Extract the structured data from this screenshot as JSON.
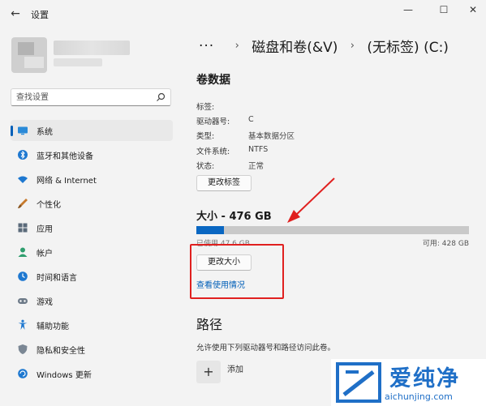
{
  "window": {
    "title": "设置",
    "back_glyph": "←",
    "min_glyph": "—",
    "max_glyph": "☐",
    "close_glyph": "✕"
  },
  "search": {
    "placeholder": "查找设置"
  },
  "sidebar": {
    "items": [
      {
        "label": "系统",
        "icon": "monitor-icon",
        "active": true
      },
      {
        "label": "蓝牙和其他设备",
        "icon": "bluetooth-icon"
      },
      {
        "label": "网络 & Internet",
        "icon": "wifi-icon"
      },
      {
        "label": "个性化",
        "icon": "brush-icon"
      },
      {
        "label": "应用",
        "icon": "apps-icon"
      },
      {
        "label": "帐户",
        "icon": "person-icon"
      },
      {
        "label": "时间和语言",
        "icon": "globe-clock-icon"
      },
      {
        "label": "游戏",
        "icon": "gamepad-icon"
      },
      {
        "label": "辅助功能",
        "icon": "accessibility-icon"
      },
      {
        "label": "隐私和安全性",
        "icon": "shield-icon"
      },
      {
        "label": "Windows 更新",
        "icon": "update-icon"
      }
    ]
  },
  "breadcrumb": {
    "more": "···",
    "sep": "›",
    "level1": "磁盘和卷(&V)",
    "level2": "(无标签) (C:)"
  },
  "volume": {
    "title": "卷数据",
    "props": [
      {
        "label": "标签:",
        "value": ""
      },
      {
        "label": "驱动器号:",
        "value": "C"
      },
      {
        "label": "类型:",
        "value": "基本数据分区"
      },
      {
        "label": "文件系统:",
        "value": "NTFS"
      },
      {
        "label": "状态:",
        "value": "正常"
      }
    ],
    "change_label_button": "更改标签"
  },
  "size": {
    "title": "大小 - 476 GB",
    "used_text": "已使用 47.6 GB",
    "free_text": "可用: 428 GB",
    "used_fraction": 0.1,
    "change_size_button": "更改大小",
    "view_usage_link": "查看使用情况"
  },
  "path": {
    "title": "路径",
    "description": "允许使用下列驱动器号和路径访问此卷。",
    "add_glyph": "+",
    "add_label": "添加"
  },
  "watermark": {
    "text_cn": "爱纯净",
    "text_en": "aichunjing.com"
  },
  "colors": {
    "accent": "#005fb8",
    "annotation_red": "#e0201f",
    "watermark_blue": "#1f6fc7"
  }
}
